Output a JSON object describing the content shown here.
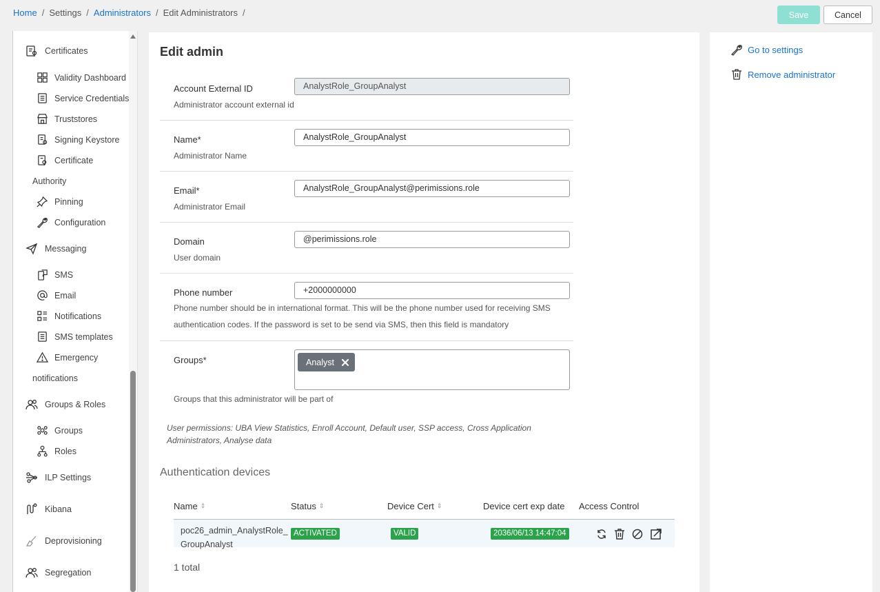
{
  "breadcrumb": [
    "Home",
    "Settings",
    "Administrators",
    "Edit Administrators"
  ],
  "breadcrumb_trailing_sep": "/",
  "actions": {
    "save": "Save",
    "cancel": "Cancel"
  },
  "sidebar": {
    "certificates": "Certificates",
    "validity_dashboard": "Validity Dashboard",
    "service_credentials": "Service Credentials",
    "truststores": "Truststores",
    "signing_keystore": "Signing Keystore",
    "certificate": "Certificate",
    "authority": "Authority",
    "pinning": "Pinning",
    "configuration": "Configuration",
    "messaging": "Messaging",
    "sms": "SMS",
    "email": "Email",
    "notifications": "Notifications",
    "sms_templates": "SMS templates",
    "emergency": "Emergency",
    "emergency_wrap": "notifications",
    "groups_roles": "Groups & Roles",
    "groups": "Groups",
    "roles": "Roles",
    "ilp_settings": "ILP Settings",
    "kibana": "Kibana",
    "deprovisioning": "Deprovisioning",
    "segregation": "Segregation"
  },
  "form": {
    "title": "Edit admin",
    "external_id": {
      "label": "Account External ID",
      "value": "AnalystRole_GroupAnalyst",
      "help": "Administrator account external id"
    },
    "name": {
      "label": "Name*",
      "value": "AnalystRole_GroupAnalyst",
      "help": "Administrator Name"
    },
    "email": {
      "label": "Email*",
      "value": "AnalystRole_GroupAnalyst@perimissions.role",
      "help": "Administrator Email"
    },
    "domain": {
      "label": "Domain",
      "value": "@perimissions.role",
      "help": "User domain"
    },
    "phone": {
      "label": "Phone number",
      "value": "+2000000000",
      "help": "Phone number should be in international format. This will be the phone number used for receiving SMS authentication codes. If the password is set to be send via SMS, then this field is mandatory"
    },
    "groups": {
      "label": "Groups*",
      "tag": "Analyst",
      "help": "Groups that this administrator will be part of"
    },
    "permissions": "User permissions: UBA View Statistics, Enroll Account, Default user, SSP access, Cross Application Administrators, Analyse data"
  },
  "devices": {
    "title": "Authentication devices",
    "columns": {
      "name": "Name",
      "status": "Status",
      "device_cert": "Device Cert",
      "exp": "Device cert exp date",
      "access": "Access Control"
    },
    "rows": [
      {
        "name": "poc26_admin_AnalystRole_GroupAnalyst",
        "status": "ACTIVATED",
        "cert": "VALID",
        "exp": "2036/06/13 14:47:04"
      }
    ],
    "total": "1 total"
  },
  "right_panel": {
    "settings": "Go to settings",
    "remove": "Remove administrator"
  },
  "colors": {
    "link": "#1a73c8",
    "save_disabled": "#8ee0d3",
    "badge_green": "#2aa34a",
    "tag_bg": "#6b7178"
  }
}
